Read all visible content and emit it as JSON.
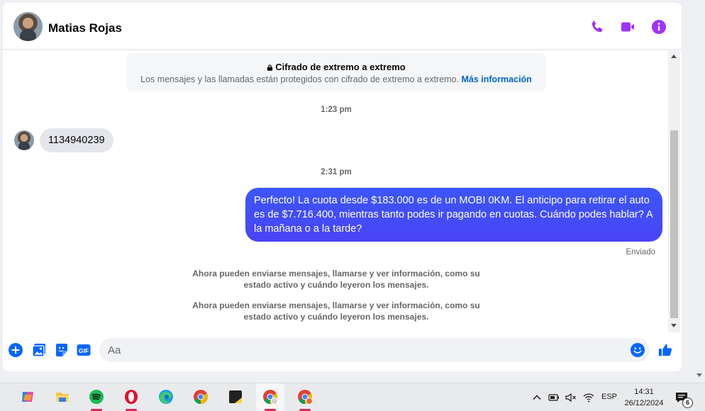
{
  "header": {
    "contact_name": "Matias Rojas",
    "accent_color": "#a033ff",
    "icons": [
      "phone-icon",
      "video-icon",
      "info-icon"
    ]
  },
  "thread": {
    "encryption": {
      "title": "Cifrado de extremo a extremo",
      "text": "Los mensajes y las llamadas están protegidos con cifrado de extremo a extremo.",
      "link": "Más información"
    },
    "timestamp_1": "1:23 pm",
    "incoming_message": "1134940239",
    "timestamp_2": "2:31 pm",
    "outgoing_message": "Perfecto! La cuota desde $183.000 es de un MOBI 0KM. El anticipo para retirar el auto es de $7.716.400, mientras tanto podes ir pagando en cuotas. Cuándo podes hablar? A la mañana o a la tarde?",
    "outgoing_status": "Enviado",
    "system_note_1": "Ahora pueden enviarse mensajes, llamarse y ver información, como su estado activo y cuándo leyeron los mensajes.",
    "system_note_2": "Ahora pueden enviarse mensajes, llamarse y ver información, como su estado activo y cuándo leyeron los mensajes."
  },
  "composer": {
    "placeholder": "Aa",
    "icons": [
      "plus-icon",
      "photo-icon",
      "sticker-icon",
      "gif-icon",
      "emoji-icon",
      "like-icon"
    ],
    "gif_label": "GIF"
  },
  "taskbar": {
    "apps": [
      "copilot",
      "file-explorer",
      "spotify",
      "opera",
      "edge",
      "chrome",
      "sticky-notes",
      "chrome-profile",
      "chrome-profile-2"
    ],
    "language": "ESP",
    "time": "14:31",
    "date": "26/12/2024",
    "notification_count": "6"
  }
}
